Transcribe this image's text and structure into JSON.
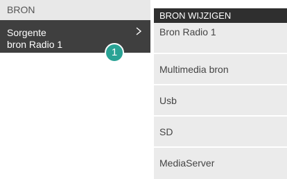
{
  "left_panel": {
    "title": "BRON",
    "item": {
      "line1": "Sorgente",
      "line2": "bron Radio 1"
    },
    "callout": "1"
  },
  "right_panel": {
    "title": "BRON WIJZIGEN",
    "items": [
      {
        "label": "Bron Radio 1"
      },
      {
        "label": "Multimedia bron"
      },
      {
        "label": "Usb"
      },
      {
        "label": "SD"
      },
      {
        "label": "MediaServer"
      }
    ]
  },
  "colors": {
    "accent": "#2aa395",
    "dark_item": "#3f3f3f",
    "header_bg": "#e8e8e8"
  },
  "icons": {
    "chevron": "chevron-right-icon"
  }
}
